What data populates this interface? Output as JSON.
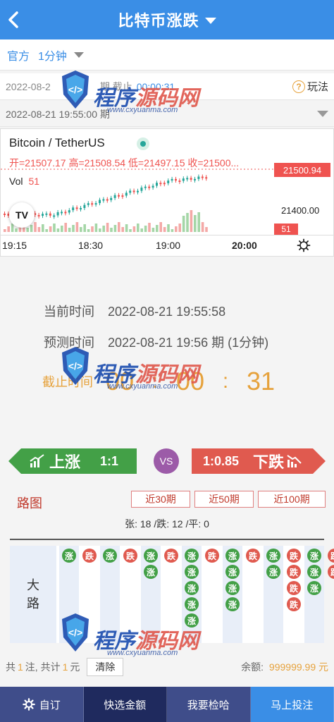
{
  "header": {
    "title": "比特币涨跌"
  },
  "typebar": {
    "source": "官方",
    "interval": "1分钟"
  },
  "period": {
    "label": "2022-08-2",
    "deadline_label": "期 截止",
    "deadline": "00:00:31",
    "howto": "玩法"
  },
  "last_period": {
    "label": "2022-08-21 19:55:00 期"
  },
  "chart": {
    "symbol": "Bitcoin / TetherUS",
    "ohlc": "开=21507.17 高=21508.54 低=21497.15 收=21500...",
    "vol_label": "Vol",
    "vol_value": "51",
    "price_tag": "21500.94",
    "axis_price": "21400.00",
    "vol_tag": "51",
    "logo": "TV",
    "x_ticks": [
      "19:15",
      "18:30",
      "19:00",
      "20:00"
    ]
  },
  "chart_data": {
    "type": "candlestick",
    "title": "Bitcoin / TetherUS",
    "x_ticks": [
      "19:15",
      "18:30",
      "19:00",
      "20:00"
    ],
    "last_price": 21500.94,
    "price_axis_label": 21400.0,
    "open": 21507.17,
    "high": 21508.54,
    "low": 21497.15,
    "volume": 51
  },
  "info": {
    "current_label": "当前时间",
    "current_value": "2022-08-21 19:55:58",
    "predict_label": "预测时间",
    "predict_value": "2022-08-21 19:56 期 (1分钟)",
    "countdown_label": "截止时间",
    "countdown": [
      "00",
      ":",
      "00",
      ":",
      "31"
    ]
  },
  "bet": {
    "up_label": "上涨",
    "up_odds": "1:1",
    "vs": "VS",
    "down_odds": "1:0.85",
    "down_label": "下跌"
  },
  "road": {
    "title": "路图",
    "filters": [
      "近30期",
      "近50期",
      "近100期"
    ],
    "stats": "张: 18 /跌: 12 /平: 0",
    "big_label": "大路",
    "up_char": "涨",
    "down_char": "跌",
    "columns": [
      [
        "涨"
      ],
      [
        "跌"
      ],
      [
        "涨"
      ],
      [
        "跌"
      ],
      [
        "涨",
        "涨"
      ],
      [
        "跌"
      ],
      [
        "涨",
        "涨",
        "涨",
        "涨",
        "涨"
      ],
      [
        "跌"
      ],
      [
        "涨",
        "涨",
        "涨",
        "涨"
      ],
      [
        "跌"
      ],
      [
        "涨",
        "涨"
      ],
      [
        "跌",
        "跌",
        "跌",
        "跌"
      ],
      [
        "涨",
        "涨",
        "涨"
      ],
      [
        "跌",
        "跌"
      ]
    ]
  },
  "footer": {
    "total_prefix": "共",
    "count": "1",
    "count_unit": "注, 共计",
    "amount": "1",
    "amount_unit": "元",
    "clear": "清除",
    "balance_label": "余额:",
    "balance": "999999.99 元"
  },
  "tabs": [
    "自订",
    "快选金额",
    "我要检哈",
    "马上投注"
  ],
  "watermark": {
    "brand_a": "程序",
    "brand_b": "源码网",
    "url": "www.cxyuanma.com"
  },
  "colors": {
    "primary": "#3a8ee6",
    "up": "#43a047",
    "down": "#e05a4f",
    "accent": "#e6a23c"
  }
}
